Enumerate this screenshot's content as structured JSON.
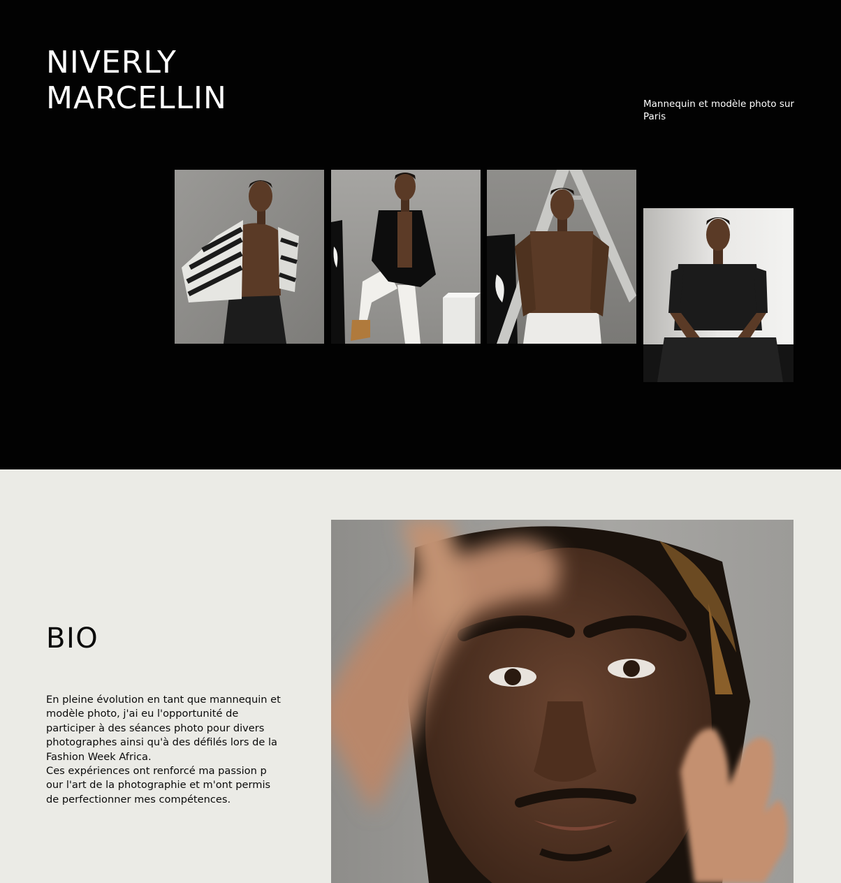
{
  "hero": {
    "name_line1": "NIVERLY",
    "name_line2": "MARCELLIN",
    "tagline": "Mannequin et modèle photo sur Paris",
    "photos": [
      "model-striped-shirt-photo",
      "model-black-blazer-photo",
      "model-ladder-photo",
      "model-black-top-seated-photo"
    ]
  },
  "bio": {
    "title": "BIO",
    "paragraph1": "En pleine évolution en tant que mannequin et modèle photo, j'ai eu l'opportunité de participer à des séances photo pour divers photographes ainsi qu'à des défilés lors de la Fashion Week Africa.",
    "paragraph2": "Ces expériences ont renforcé ma passion p our l'art de la photographie et m'ont permis de perfectionner mes compétences.",
    "portrait": "model-closeup-portrait-photo"
  },
  "colors": {
    "hero_bg": "#020202",
    "bio_bg": "#ebebe6",
    "text_light": "#ffffff",
    "text_dark": "#0a0a0a",
    "photo_bg": "#8c8c89"
  }
}
